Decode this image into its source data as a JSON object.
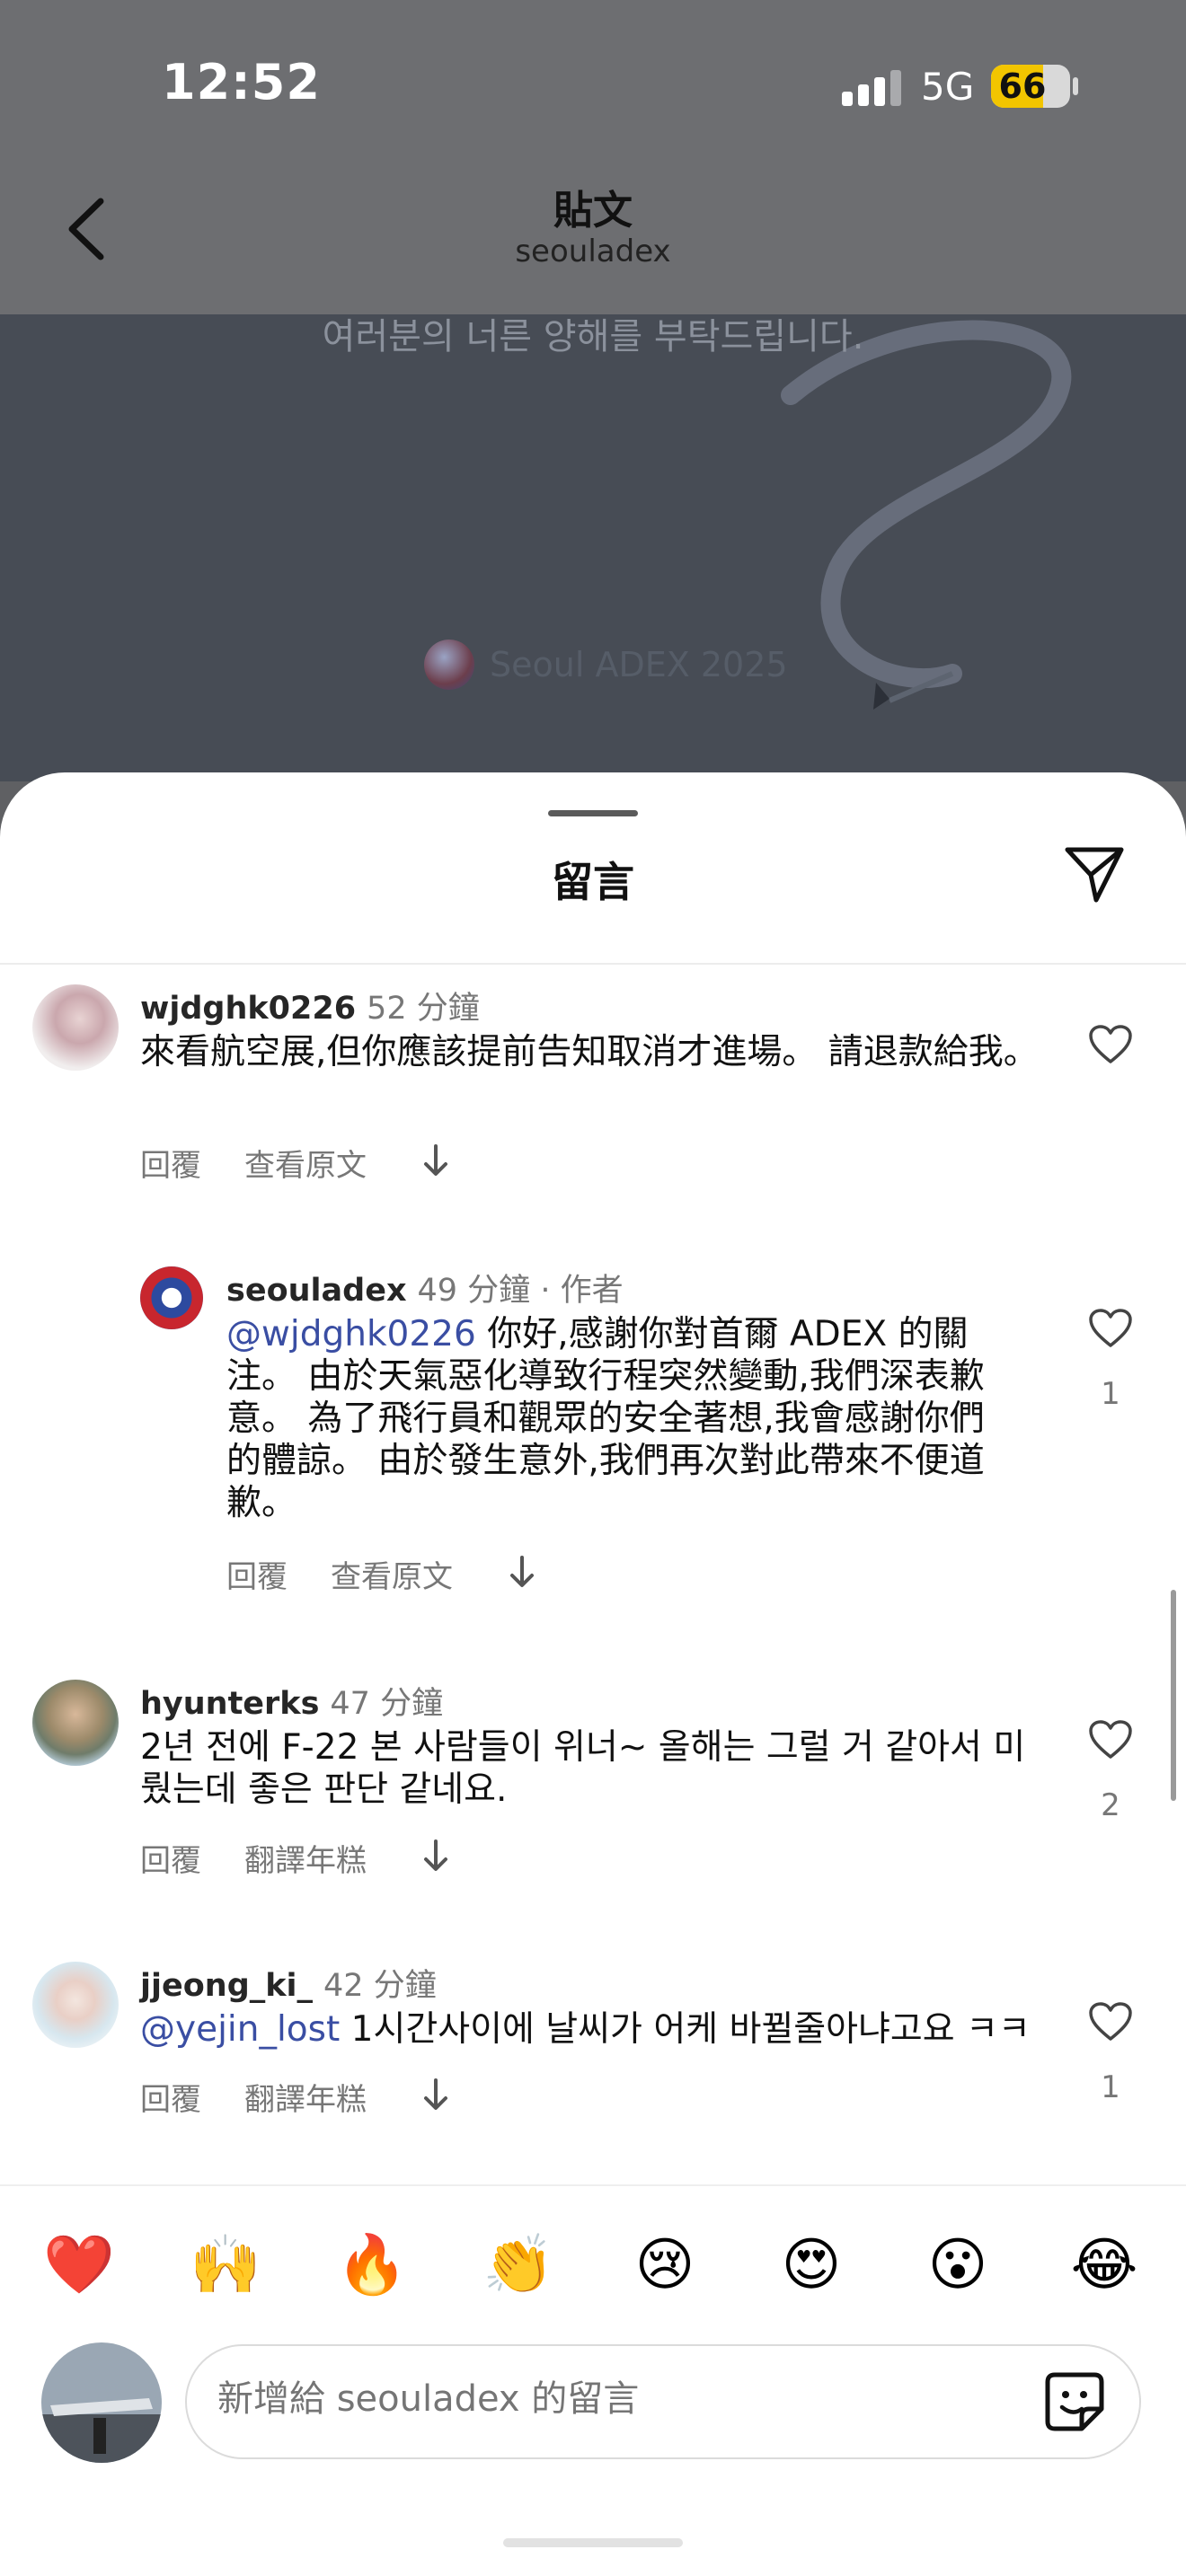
{
  "status_bar": {
    "time": "12:52",
    "network": "5G",
    "battery": "66",
    "battery_level": 0.66
  },
  "header": {
    "title": "貼文",
    "subtitle": "seouladex"
  },
  "post_image": {
    "caption": "여러분의 너른 양해를 부탁드립니다.",
    "logo_text": "Seoul ADEX 2025"
  },
  "sheet": {
    "title": "留言"
  },
  "comments": [
    {
      "username": "wjdghk0226",
      "time": "52 分鐘",
      "author_tag": "",
      "mention": "",
      "text": "來看航空展,但你應該提前告知取消才進場。 請退款給我。",
      "actions": [
        "回覆",
        "查看原文"
      ],
      "likes": ""
    },
    {
      "username": "seouladex",
      "time": "49 分鐘",
      "author_tag": " · 作者",
      "mention": "@wjdghk0226",
      "text": " 你好,感謝你對首爾 ADEX 的關注。 由於天氣惡化導致行程突然變動,我們深表歉意。 為了飛行員和觀眾的安全著想,我會感謝你們的體諒。 由於發生意外,我們再次對此帶來不便道歉。",
      "actions": [
        "回覆",
        "查看原文"
      ],
      "likes": "1"
    },
    {
      "username": "hyunterks",
      "time": "47 分鐘",
      "author_tag": "",
      "mention": "",
      "text": "2년 전에 F-22 본 사람들이 위너~ 올해는 그럴 거 같아서 미뤘는데 좋은 판단 같네요.",
      "actions": [
        "回覆",
        "翻譯年糕"
      ],
      "likes": "2"
    },
    {
      "username": "jjeong_ki_",
      "time": "42 分鐘",
      "author_tag": "",
      "mention": "@yejin_lost",
      "text": " 1시간사이에 날씨가 어케 바뀔줄아냐고요 ㅋㅋ",
      "actions": [
        "回覆",
        "翻譯年糕"
      ],
      "likes": "1"
    }
  ],
  "emoji_bar": [
    "❤️",
    "🙌",
    "🔥",
    "👏",
    "😢",
    "😍",
    "😮",
    "😂"
  ],
  "composer": {
    "placeholder": "新增給 seouladex 的留言"
  }
}
